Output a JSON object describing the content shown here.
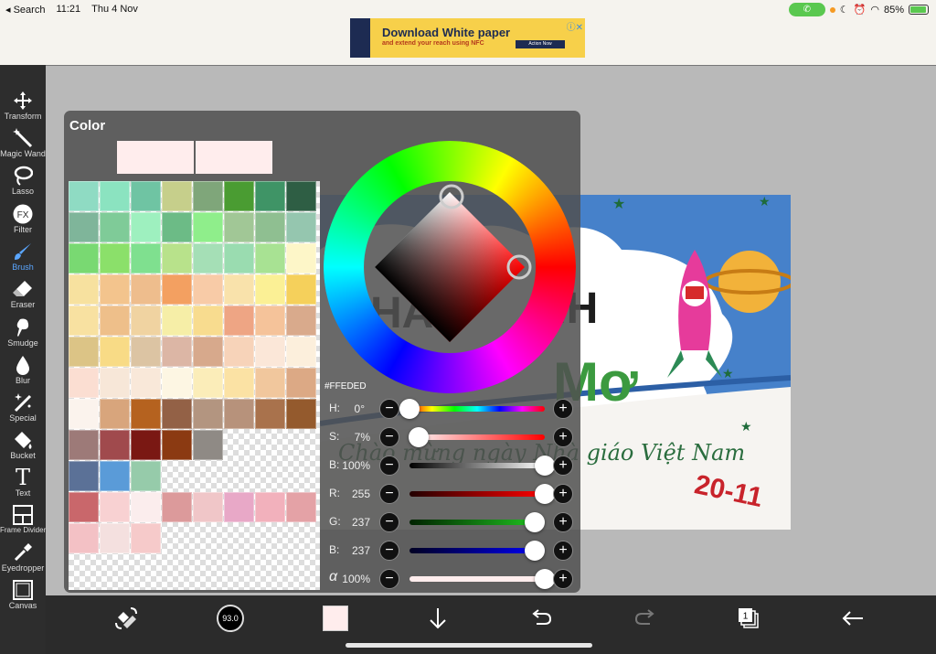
{
  "status_bar": {
    "back_label": "◂ Search",
    "time": "11:21",
    "date": "Thu 4 Nov",
    "battery": "85%",
    "battery_level": 0.85
  },
  "ad": {
    "headline": "Download White paper",
    "subline": "and extend your reach using NFC",
    "button": "Action Now",
    "close": "ⓘ✕"
  },
  "toolbar": {
    "tools": [
      {
        "id": "transform",
        "label": "Transform",
        "icon": "move-arrows-icon"
      },
      {
        "id": "magic-wand",
        "label": "Magic Wand",
        "icon": "magic-wand-icon"
      },
      {
        "id": "lasso",
        "label": "Lasso",
        "icon": "lasso-icon"
      },
      {
        "id": "filter",
        "label": "Filter",
        "icon": "fx-icon"
      },
      {
        "id": "brush",
        "label": "Brush",
        "icon": "brush-icon"
      },
      {
        "id": "eraser",
        "label": "Eraser",
        "icon": "eraser-icon"
      },
      {
        "id": "smudge",
        "label": "Smudge",
        "icon": "smudge-icon"
      },
      {
        "id": "blur",
        "label": "Blur",
        "icon": "drop-icon"
      },
      {
        "id": "special",
        "label": "Special",
        "icon": "sparkle-wand-icon"
      },
      {
        "id": "bucket",
        "label": "Bucket",
        "icon": "bucket-icon"
      },
      {
        "id": "text",
        "label": "Text",
        "icon": "text-t-icon"
      },
      {
        "id": "frame-divider",
        "label": "Frame Divider",
        "icon": "frame-divider-icon"
      },
      {
        "id": "eyedropper",
        "label": "Eyedropper",
        "icon": "eyedropper-icon"
      },
      {
        "id": "canvas",
        "label": "Canvas",
        "icon": "canvas-icon"
      }
    ],
    "active": "brush",
    "fx_glyph": "FX",
    "text_glyph": "T"
  },
  "color_panel": {
    "title": "Color",
    "hex": "#FFEDED",
    "current_color": "#ffeded",
    "previous_color": "#ffeded",
    "palette": [
      [
        "#8fdbc3",
        "#8be3c0",
        "#6fc4a3",
        "#c6cf8b",
        "#7fa67a",
        "#4a9c32",
        "#3f9466",
        "#2e5e44"
      ],
      [
        "#7fb59a",
        "#7fcb98",
        "#9ef0bf",
        "#6cbb86",
        "#8fee8b",
        "#a1c796",
        "#8fbf91",
        "#95c6af"
      ],
      [
        "#79d972",
        "#8be06a",
        "#7fe08f",
        "#b8e28b",
        "#a5dfb6",
        "#9adcb0",
        "#a8e293",
        "#fdf6c8"
      ],
      [
        "#f7e19f",
        "#f3c48d",
        "#eebd8d",
        "#f3a061",
        "#f8cba7",
        "#f9e2ab",
        "#fbf095",
        "#f5d05b"
      ],
      [
        "#f8e1a1",
        "#eebf8a",
        "#f0d3a1",
        "#f6eea7",
        "#f8dc8f",
        "#eea584",
        "#f5c39a",
        "#d9aa8c"
      ],
      [
        "#dcc486",
        "#f8db86",
        "#dcc4a3",
        "#dcb6a5",
        "#d7a98c",
        "#f7d3b9",
        "#fbe7d8",
        "#fcefdc"
      ],
      [
        "#fbded2",
        "#f7e7d8",
        "#f9e8d9",
        "#fdf6e3",
        "#fbedb9",
        "#fbe2a4",
        "#f1c79d",
        "#dca985"
      ],
      [
        "#fbf3ed",
        "#d8a57c",
        "#b5621f",
        "#936146",
        "#b39580",
        "#b7927b",
        "#a9724c",
        "#945a2d"
      ],
      [
        "#9d7a78",
        "#a04a4d",
        "#7a1813",
        "#8b3a12",
        "#8f8a85",
        null,
        null,
        null
      ],
      [
        "#5b7197",
        "#5a9bd8",
        "#96cbaa",
        null,
        null,
        null,
        null,
        null
      ],
      [
        "#c9676b",
        "#f8d1d2",
        "#fbeded",
        "#dc9a9b",
        "#f0c6c8",
        "#e8a8c7",
        "#f2b1bc",
        "#e4a2a6"
      ],
      [
        "#f3c1c5",
        "#f4e0df",
        "#f6caca",
        null,
        null,
        null,
        null,
        null
      ]
    ],
    "hsb": {
      "h": 0,
      "s": 7,
      "b": 100
    },
    "sliders": [
      {
        "id": "hue",
        "name": "H:",
        "value": "0°",
        "fraction": 0.0
      },
      {
        "id": "saturation",
        "name": "S:",
        "value": "7%",
        "fraction": 0.07
      },
      {
        "id": "brightness",
        "name": "B:",
        "value": "100%",
        "fraction": 1.0
      },
      {
        "id": "red",
        "name": "R:",
        "value": "255",
        "fraction": 1.0
      },
      {
        "id": "green",
        "name": "G:",
        "value": "237",
        "fraction": 0.929
      },
      {
        "id": "blue",
        "name": "B:",
        "value": "237",
        "fraction": 0.929
      },
      {
        "id": "alpha",
        "name": "α",
        "value": "100%",
        "fraction": 1.0
      }
    ],
    "minus": "−",
    "plus": "+"
  },
  "bottom_bar": {
    "brush_size": "93.0",
    "layer_count": "1",
    "items": [
      "swap-colors-icon",
      "brush-size-indicator",
      "current-color-swatch",
      "download-arrow-icon",
      "undo-icon",
      "redo-icon",
      "layers-icon",
      "back-arrow-icon"
    ]
  }
}
